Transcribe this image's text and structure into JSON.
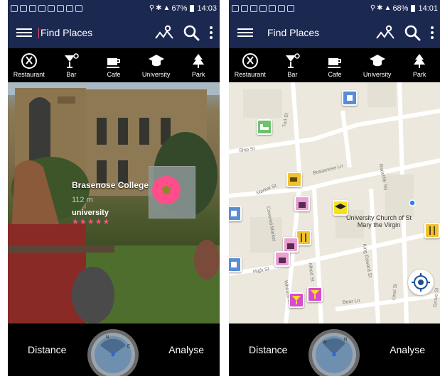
{
  "colors": {
    "app_bar": "#1b2850",
    "accent_pink": "#ff4e8a",
    "map_bg": "#ece8de"
  },
  "left": {
    "status": {
      "signal_text": "67%",
      "time": "14:03"
    },
    "search": {
      "title": "Find Places"
    },
    "categories": [
      {
        "label": "Restaurant",
        "icon": "restaurant-icon"
      },
      {
        "label": "Bar",
        "icon": "bar-icon"
      },
      {
        "label": "Cafe",
        "icon": "cafe-icon"
      },
      {
        "label": "University",
        "icon": "university-icon"
      },
      {
        "label": "Park",
        "icon": "park-icon"
      }
    ],
    "ar_place": {
      "name": "Brasenose College",
      "distance": "112 m",
      "type": "university",
      "rating": 5
    },
    "bottom": {
      "distance_label": "Distance",
      "analyse_label": "Analyse"
    }
  },
  "right": {
    "status": {
      "signal_text": "68%",
      "time": "14:01"
    },
    "search": {
      "title": "Find Places"
    },
    "categories": [
      {
        "label": "Restaurant",
        "icon": "restaurant-icon"
      },
      {
        "label": "Bar",
        "icon": "bar-icon"
      },
      {
        "label": "Cafe",
        "icon": "cafe-icon"
      },
      {
        "label": "University",
        "icon": "university-icon"
      },
      {
        "label": "Park",
        "icon": "park-icon"
      }
    ],
    "map": {
      "poi_label": "University Church of St Mary the Virgin",
      "streets": [
        "Turl St",
        "Ship St",
        "Brasenose Ln",
        "Radcliffe Sq",
        "Market St",
        "Covered Market",
        "High St",
        "Alfred St",
        "Wheatsheaf",
        "King Edward St",
        "Bear Ln",
        "Oriel St",
        "Grove St"
      ]
    },
    "bottom": {
      "distance_label": "Distance",
      "analyse_label": "Analyse"
    }
  }
}
